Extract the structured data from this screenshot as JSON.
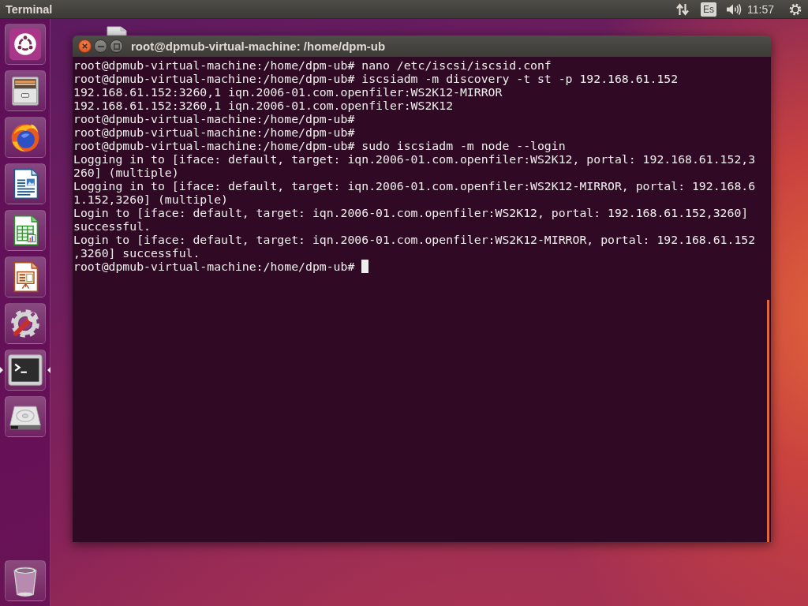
{
  "top_panel": {
    "app_title": "Terminal",
    "indicators": [
      {
        "kind": "network"
      },
      {
        "kind": "keyboard",
        "label": "Es"
      },
      {
        "kind": "sound"
      },
      {
        "kind": "clock",
        "label": "11:57"
      },
      {
        "kind": "session"
      }
    ]
  },
  "launcher": {
    "items": [
      {
        "kind": "dash",
        "running": false,
        "focused": false
      },
      {
        "kind": "files",
        "running": false,
        "focused": false
      },
      {
        "kind": "browser",
        "running": false,
        "focused": false
      },
      {
        "kind": "writer",
        "running": false,
        "focused": false
      },
      {
        "kind": "calc",
        "running": false,
        "focused": false
      },
      {
        "kind": "impress",
        "running": false,
        "focused": false
      },
      {
        "kind": "settings",
        "running": false,
        "focused": false
      },
      {
        "kind": "terminal",
        "running": true,
        "focused": true
      },
      {
        "kind": "disk",
        "running": false,
        "focused": false
      },
      {
        "kind": "trash",
        "running": false,
        "focused": false
      }
    ]
  },
  "window": {
    "title": "root@dpmub-virtual-machine: /home/dpm-ub",
    "controls": [
      {
        "kind": "close"
      },
      {
        "kind": "minimize"
      },
      {
        "kind": "maximize"
      }
    ]
  },
  "terminal": {
    "lines": [
      "root@dpmub-virtual-machine:/home/dpm-ub# nano /etc/iscsi/iscsid.conf",
      "root@dpmub-virtual-machine:/home/dpm-ub# iscsiadm -m discovery -t st -p 192.168.61.152",
      "192.168.61.152:3260,1 iqn.2006-01.com.openfiler:WS2K12-MIRROR",
      "192.168.61.152:3260,1 iqn.2006-01.com.openfiler:WS2K12",
      "root@dpmub-virtual-machine:/home/dpm-ub#",
      "root@dpmub-virtual-machine:/home/dpm-ub#",
      "root@dpmub-virtual-machine:/home/dpm-ub# sudo iscsiadm -m node --login",
      "Logging in to [iface: default, target: iqn.2006-01.com.openfiler:WS2K12, portal: 192.168.61.152,3",
      "260] (multiple)",
      "Logging in to [iface: default, target: iqn.2006-01.com.openfiler:WS2K12-MIRROR, portal: 192.168.6",
      "1.152,3260] (multiple)",
      "Login to [iface: default, target: iqn.2006-01.com.openfiler:WS2K12, portal: 192.168.61.152,3260]",
      "successful.",
      "Login to [iface: default, target: iqn.2006-01.com.openfiler:WS2K12-MIRROR, portal: 192.168.61.152",
      ",3260] successful."
    ],
    "prompt": "root@dpmub-virtual-machine:/home/dpm-ub#",
    "cursor": true
  }
}
